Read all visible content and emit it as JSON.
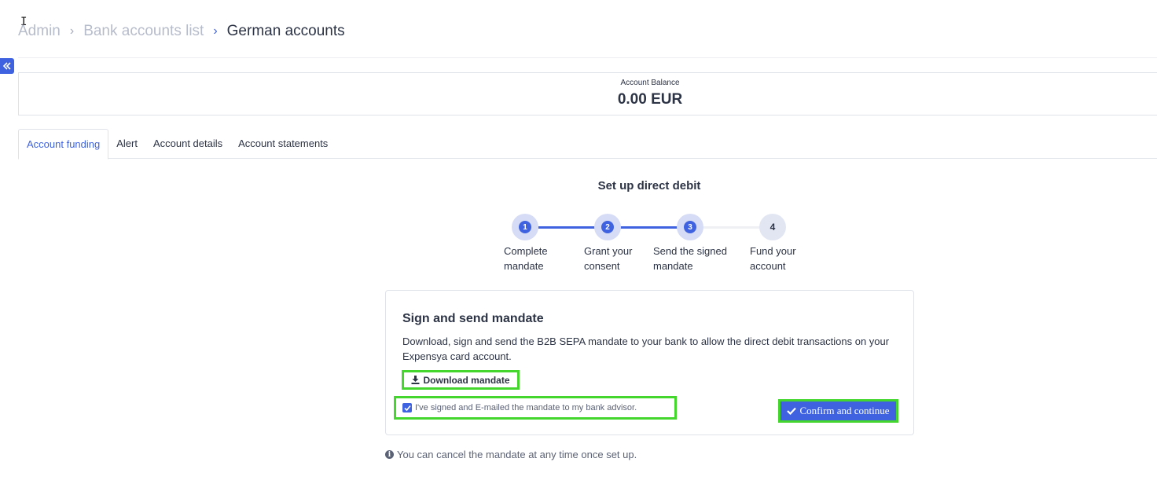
{
  "breadcrumb": {
    "items": [
      "Admin",
      "Bank accounts list"
    ],
    "current": "German accounts"
  },
  "balance": {
    "label": "Account Balance",
    "value": "0.00 EUR"
  },
  "tabs": [
    {
      "label": "Account funding",
      "active": true
    },
    {
      "label": "Alert",
      "active": false
    },
    {
      "label": "Account details",
      "active": false
    },
    {
      "label": "Account statements",
      "active": false
    }
  ],
  "stepper": {
    "title": "Set up direct debit",
    "steps": [
      {
        "number": "1",
        "label_line1": "Complete",
        "label_line2": "mandate",
        "state": "done"
      },
      {
        "number": "2",
        "label_line1": "Grant your",
        "label_line2": "consent",
        "state": "done"
      },
      {
        "number": "3",
        "label_line1": "Send the signed",
        "label_line2": "mandate",
        "state": "current"
      },
      {
        "number": "4",
        "label_line1": "Fund your",
        "label_line2": "account",
        "state": "todo"
      }
    ]
  },
  "mandate": {
    "title": "Sign and send mandate",
    "description": "Download, sign and send the B2B SEPA mandate to your bank to allow the direct debit transactions on your Expensya card account.",
    "download_label": "Download mandate",
    "checkbox_label": "I've signed and E-mailed the mandate to my bank advisor.",
    "checkbox_checked": true,
    "confirm_label": "Confirm and continue"
  },
  "footnote": "You can cancel the mandate at any time once set up.",
  "colors": {
    "accent": "#3f63e0",
    "highlight": "#44d62c",
    "text": "#2c3345",
    "muted": "#b7bccb"
  }
}
